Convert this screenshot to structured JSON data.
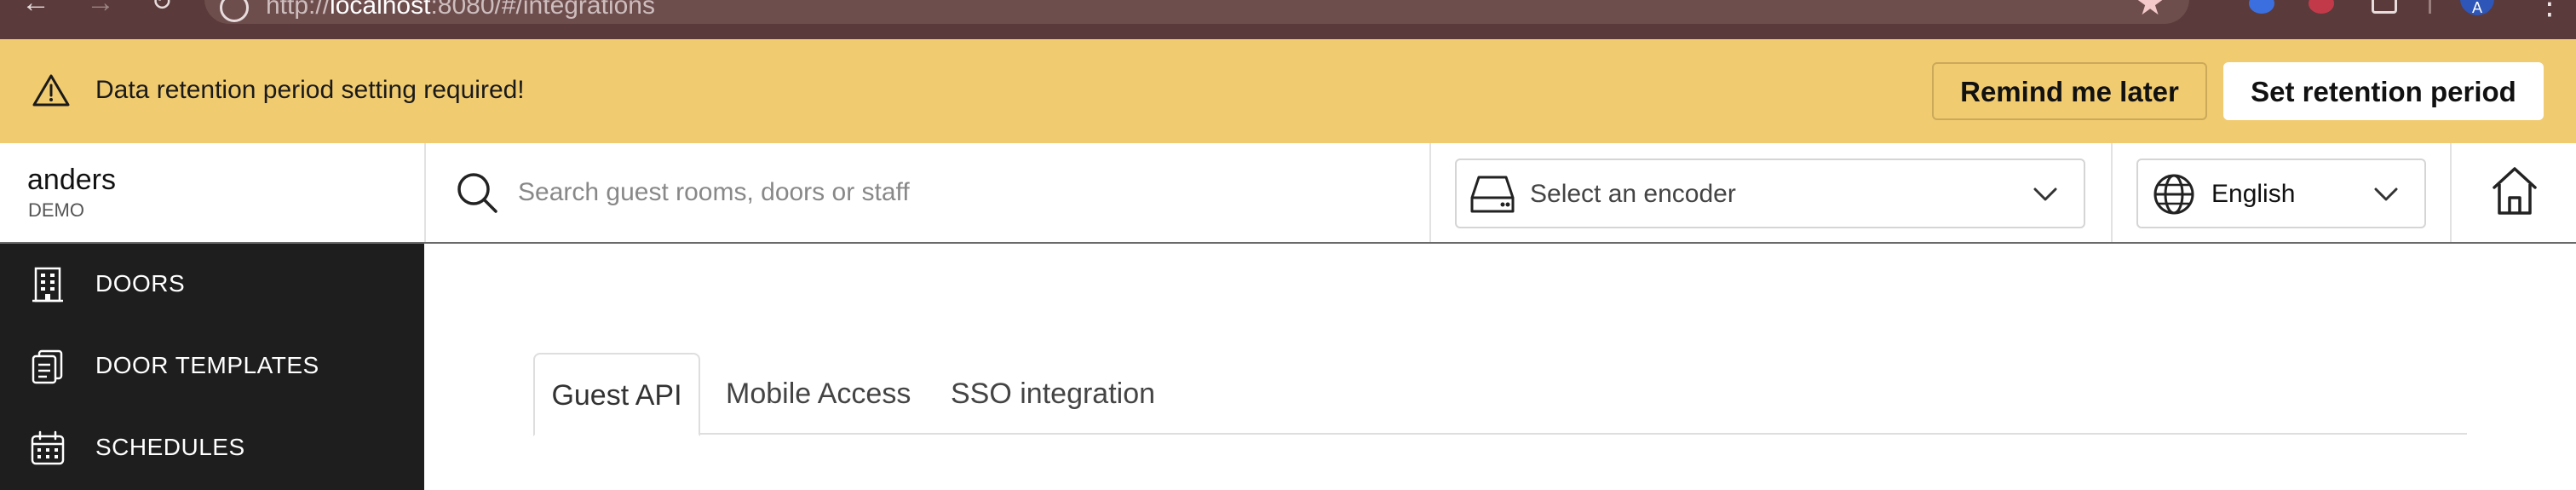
{
  "browser": {
    "url_scheme": "http://",
    "url_host": "localhost",
    "url_rest": ":8080/#/integrations",
    "profile_initial": "A"
  },
  "banner": {
    "message": "Data retention period setting required!",
    "remind_label": "Remind me later",
    "set_label": "Set retention period",
    "background_color": "#f1cb70"
  },
  "header": {
    "brand_name": "anders",
    "brand_sub": "DEMO",
    "search_placeholder": "Search guest rooms, doors or staff",
    "encoder_select": "Select an encoder",
    "language_select": "English"
  },
  "sidebar": {
    "items": [
      {
        "label": "DOORS",
        "icon": "building-icon"
      },
      {
        "label": "DOOR TEMPLATES",
        "icon": "templates-icon"
      },
      {
        "label": "SCHEDULES",
        "icon": "calendar-icon"
      }
    ],
    "background_color": "#1e1e1e"
  },
  "tabs": [
    {
      "label": "Guest API",
      "active": true
    },
    {
      "label": "Mobile Access",
      "active": false
    },
    {
      "label": "SSO integration",
      "active": false
    }
  ]
}
